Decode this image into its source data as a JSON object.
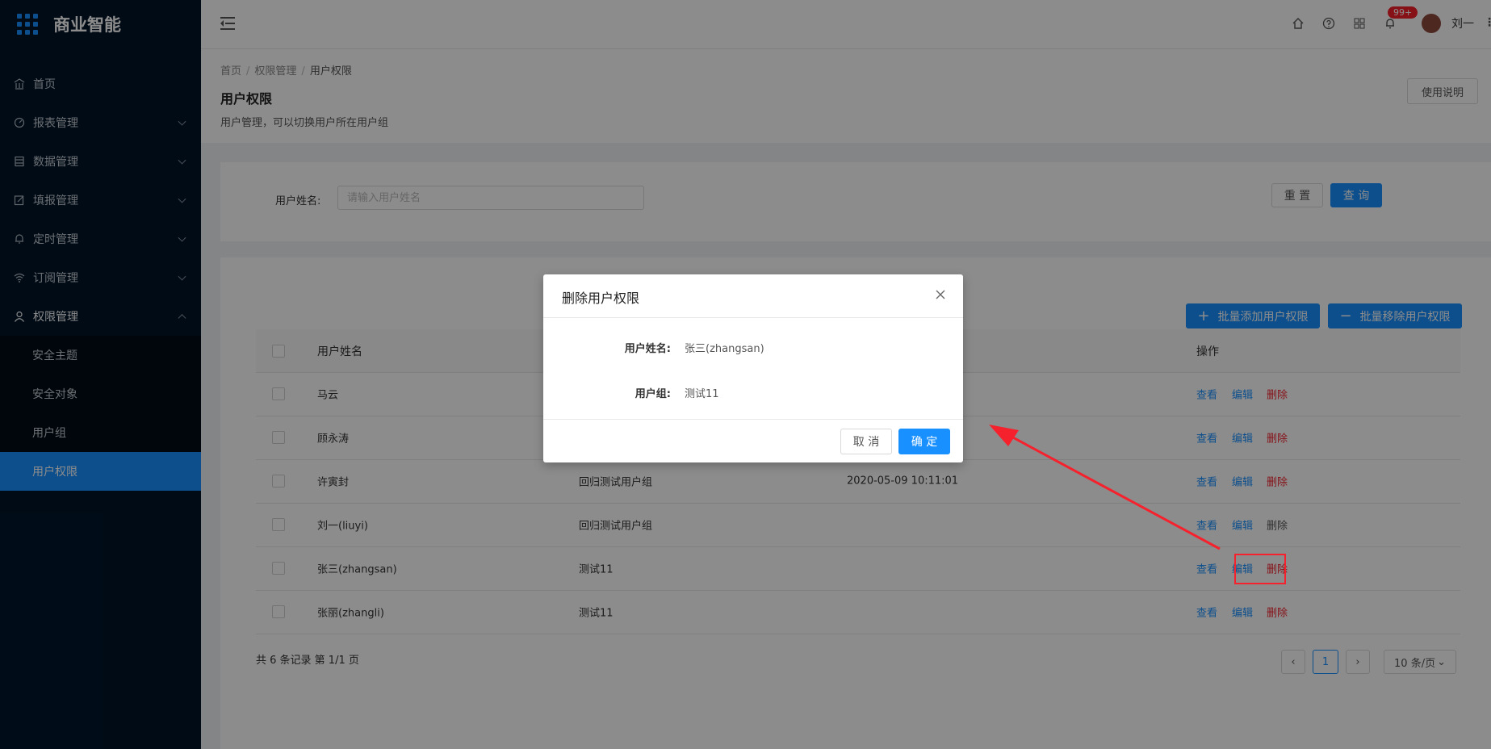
{
  "brand": {
    "title": "商业智能"
  },
  "sidebar": {
    "items": [
      {
        "label": "首页",
        "icon": "bank-icon"
      },
      {
        "label": "报表管理",
        "icon": "dashboard-icon"
      },
      {
        "label": "数据管理",
        "icon": "database-icon"
      },
      {
        "label": "填报管理",
        "icon": "form-icon"
      },
      {
        "label": "定时管理",
        "icon": "bell-icon"
      },
      {
        "label": "订阅管理",
        "icon": "wifi-icon"
      },
      {
        "label": "权限管理",
        "icon": "user-icon"
      }
    ],
    "submenu": [
      {
        "label": "安全主题"
      },
      {
        "label": "安全对象"
      },
      {
        "label": "用户组"
      },
      {
        "label": "用户权限",
        "active": true
      }
    ]
  },
  "header": {
    "badge": "99+",
    "user_name": "刘一"
  },
  "breadcrumb": {
    "home": "首页",
    "parent": "权限管理",
    "current": "用户权限"
  },
  "page": {
    "title": "用户权限",
    "desc": "用户管理，可以切换用户所在用户组",
    "help_label": "使用说明"
  },
  "search": {
    "label": "用户姓名:",
    "placeholder": "请输入用户姓名",
    "reset_label": "重 置",
    "query_label": "查 询"
  },
  "toolbar": {
    "bulk_add_label": "批量添加用户权限",
    "bulk_remove_label": "批量移除用户权限"
  },
  "table": {
    "columns": {
      "name": "用户姓名",
      "ops": "操作"
    },
    "actions": {
      "view": "查看",
      "edit": "编辑",
      "delete": "删除"
    },
    "rows": [
      {
        "name": "马云",
        "group": "",
        "time": ""
      },
      {
        "name": "顾永涛",
        "group": "",
        "time": ""
      },
      {
        "name": "许寅封",
        "group": "回归测试用户组",
        "time": "2020-05-09 10:11:01"
      },
      {
        "name": "刘一(liuyi)",
        "group": "回归测试用户组",
        "time": ""
      },
      {
        "name": "张三(zhangsan)",
        "group": "测试11",
        "time": ""
      },
      {
        "name": "张丽(zhangli)",
        "group": "测试11",
        "time": ""
      }
    ]
  },
  "pagination": {
    "total_text": "共 6 条记录 第 1/1 页",
    "current_page": "1",
    "page_size": "10 条/页"
  },
  "modal": {
    "title": "删除用户权限",
    "name_label": "用户姓名:",
    "name_value": "张三(zhangsan)",
    "group_label": "用户组:",
    "group_value": "测试11",
    "cancel_label": "取 消",
    "confirm_label": "确 定"
  },
  "colors": {
    "primary": "#1890ff",
    "danger": "#f5222d",
    "sidebar": "#001529"
  }
}
